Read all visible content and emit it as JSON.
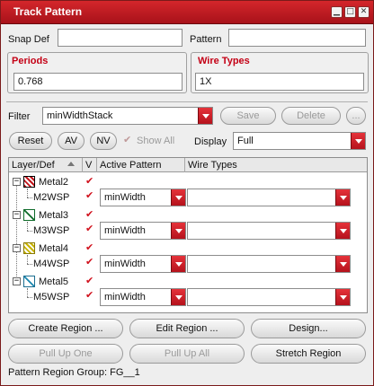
{
  "window": {
    "title": "Track Pattern"
  },
  "snap_def": {
    "label": "Snap Def",
    "value": ""
  },
  "pattern": {
    "label": "Pattern",
    "value": ""
  },
  "periods": {
    "label": "Periods",
    "value": "0.768"
  },
  "wire_types": {
    "label": "Wire Types",
    "value": "1X"
  },
  "filter": {
    "label": "Filter",
    "value": "minWidthStack",
    "save": "Save",
    "delete": "Delete",
    "more": "..."
  },
  "toolbar": {
    "reset": "Reset",
    "av": "AV",
    "nv": "NV",
    "show_all": "Show All",
    "display_label": "Display",
    "display_value": "Full"
  },
  "table": {
    "headers": [
      "Layer/Def",
      "V",
      "Active Pattern",
      "Wire Types"
    ],
    "rows": [
      {
        "layer": "Metal2",
        "def": "M2WSP",
        "pattern": "minWidth",
        "wire": "",
        "color": "#c4161c"
      },
      {
        "layer": "Metal3",
        "def": "M3WSP",
        "pattern": "minWidth",
        "wire": "",
        "color": "#0f6b2a"
      },
      {
        "layer": "Metal4",
        "def": "M4WSP",
        "pattern": "minWidth",
        "wire": "",
        "color": "#c8b400"
      },
      {
        "layer": "Metal5",
        "def": "M5WSP",
        "pattern": "minWidth",
        "wire": "",
        "color": "#1c88b0"
      }
    ]
  },
  "buttons": {
    "create_region": "Create Region ...",
    "edit_region": "Edit Region ...",
    "design": "Design...",
    "pull_up_one": "Pull Up One",
    "pull_up_all": "Pull Up All",
    "stretch_region": "Stretch Region"
  },
  "status": "Pattern Region Group: FG__1"
}
